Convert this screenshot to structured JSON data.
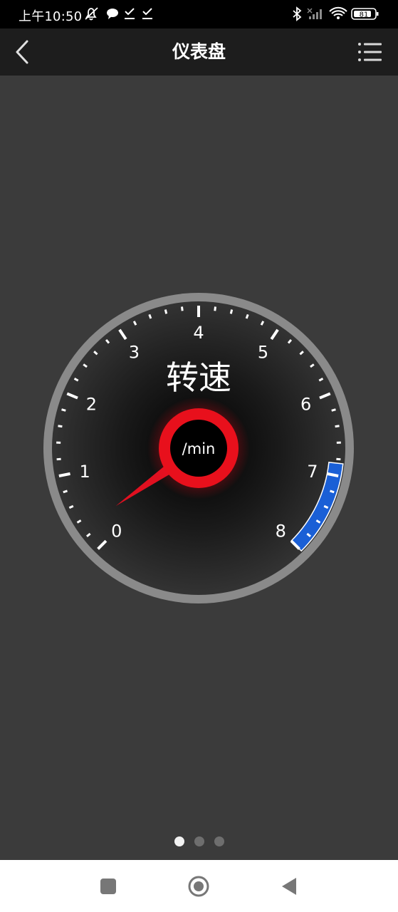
{
  "status_bar": {
    "time": "上午10:50",
    "battery": "81",
    "icons": [
      "muted-bell-icon",
      "chat-bubble-icon",
      "check-download-icon",
      "check-download-icon",
      "bluetooth-icon",
      "signal-icon",
      "wifi-icon",
      "battery-icon"
    ]
  },
  "header": {
    "title": "仪表盘",
    "back_icon": "chevron-left-icon",
    "menu_icon": "list-menu-icon"
  },
  "gauge": {
    "title": "转速",
    "unit": "/min",
    "scale_labels": [
      "0",
      "1",
      "2",
      "3",
      "4",
      "5",
      "6",
      "7",
      "8"
    ],
    "min": 0,
    "max": 8,
    "needle_value": 0.3,
    "redline_from": 6.85,
    "redline_to": 8,
    "colors": {
      "rim": "#8a8a8a",
      "face": "#1c1c1c",
      "needle": "#e01020",
      "hub_ring": "#e8101c",
      "redline_band": "#1a5fd6"
    }
  },
  "pager": {
    "count": 3,
    "active_index": 0
  },
  "nav_bar": {
    "icons": [
      "square-recents-icon",
      "circle-home-icon",
      "triangle-back-icon"
    ]
  }
}
